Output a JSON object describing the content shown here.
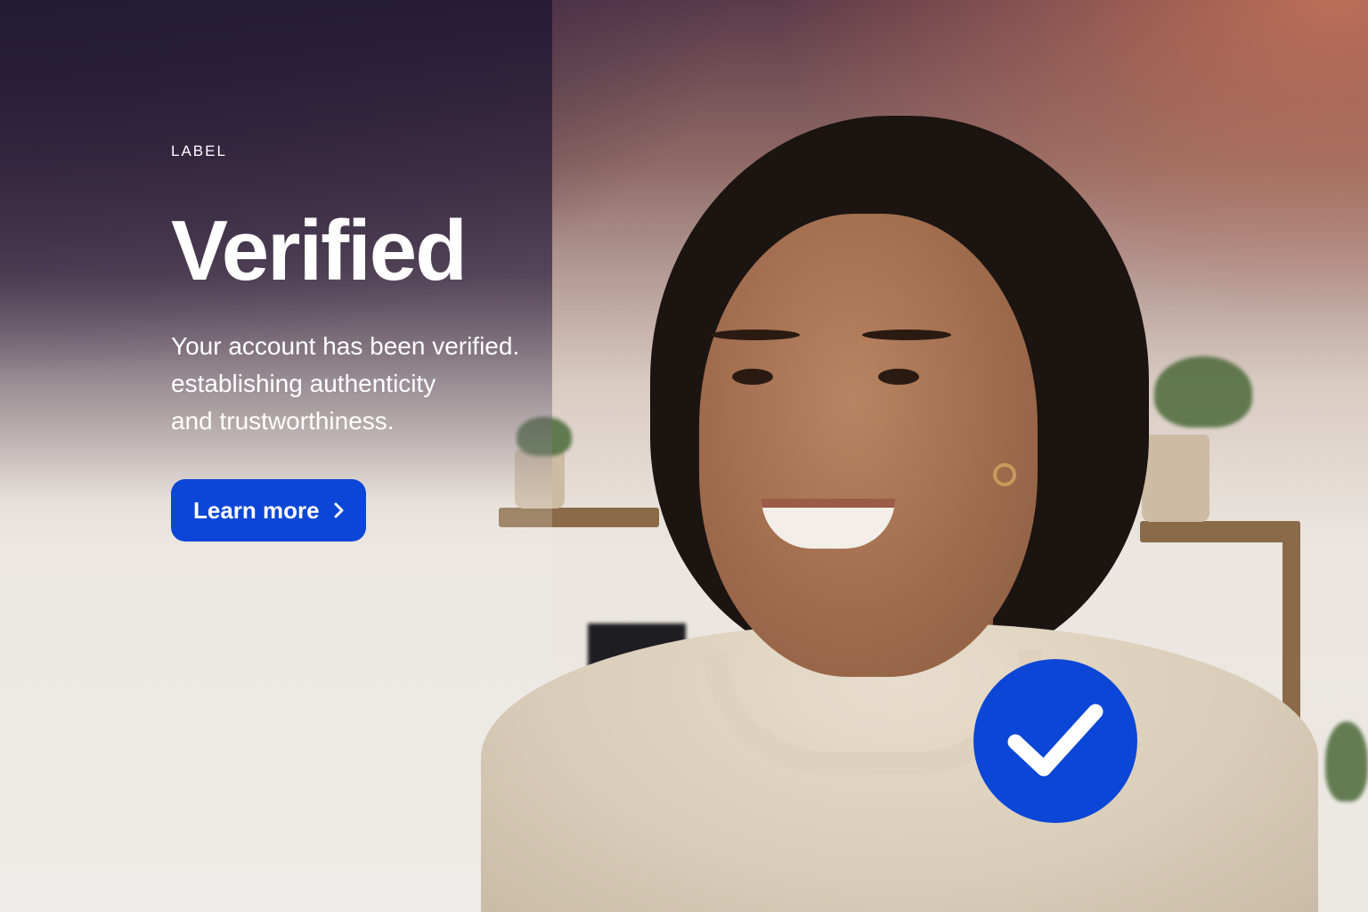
{
  "hero": {
    "eyebrow": "LABEL",
    "title": "Verified",
    "description_lines": [
      "Your account has been verified.",
      "establishing authenticity",
      "and trustworthiness."
    ],
    "cta_label": "Learn more",
    "cta_icon": "chevron-right-icon"
  },
  "badge": {
    "icon": "checkmark-icon",
    "color": "#0b46d6"
  },
  "colors": {
    "accent": "#0b46d6",
    "text": "#ffffff"
  }
}
